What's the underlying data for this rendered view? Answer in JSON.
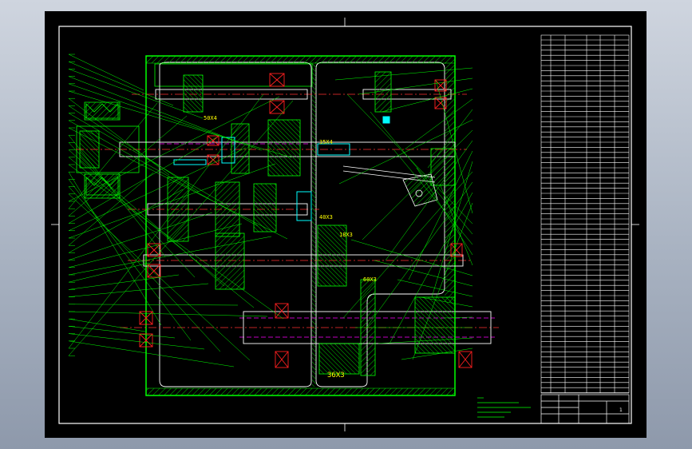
{
  "drawing": {
    "part_labels": [
      "36X3",
      "40X3",
      "18X3",
      "60X3",
      "50X4",
      "35X4"
    ],
    "title_block_text": "1",
    "colors": {
      "sheet": "#000000",
      "frame": "#ffffff",
      "outline": "#00ff00",
      "centerline": "#ff3030",
      "axis_line": "#ff00ff",
      "hatch": "#00ff00",
      "bearing": "#ff2020",
      "highlight": "#00ffff",
      "text": "#ffff00",
      "background": "#b4bccb"
    }
  }
}
